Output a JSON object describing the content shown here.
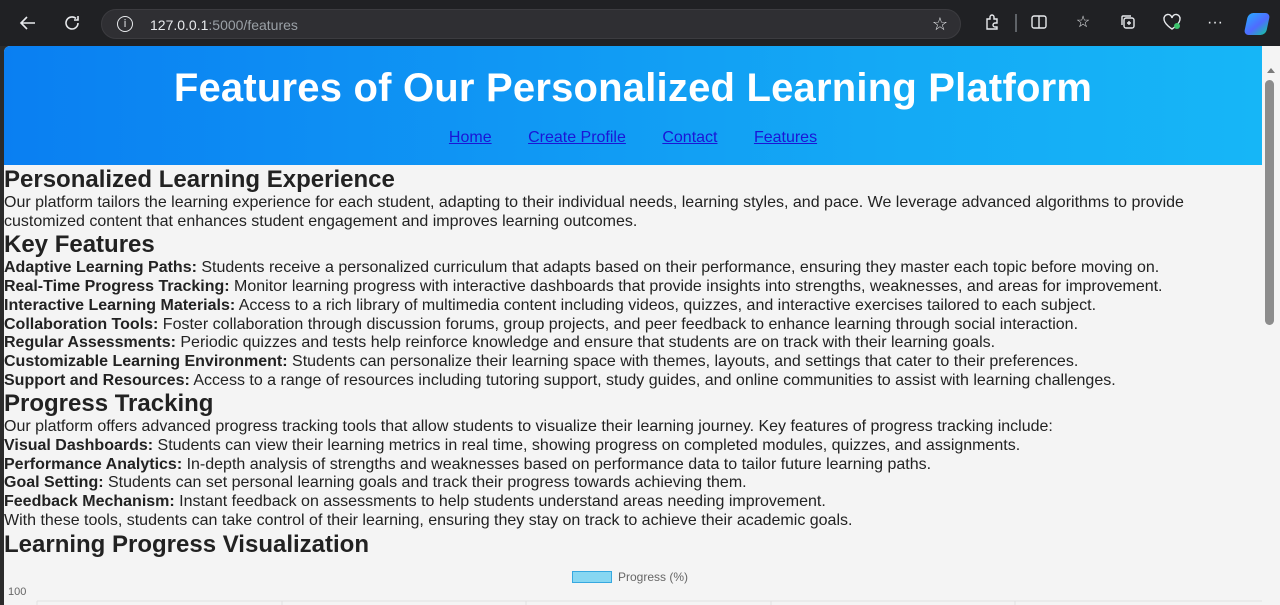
{
  "browser": {
    "url_host": "127.0.0.1",
    "url_path": ":5000/features",
    "icons": [
      "back-icon",
      "refresh-icon",
      "info-icon",
      "star-icon",
      "extensions-icon",
      "split-screen-icon",
      "favorites-icon",
      "collections-icon",
      "performance-icon",
      "more-icon",
      "copilot-icon"
    ]
  },
  "header": {
    "title": "Features of Our Personalized Learning Platform",
    "nav": [
      "Home",
      "Create Profile",
      "Contact",
      "Features"
    ]
  },
  "sections": {
    "personalized": {
      "heading": "Personalized Learning Experience",
      "text": "Our platform tailors the learning experience for each student, adapting to their individual needs, learning styles, and pace. We leverage advanced algorithms to provide customized content that enhances student engagement and improves learning outcomes."
    },
    "key_features": {
      "heading": "Key Features",
      "items": [
        {
          "label": "Adaptive Learning Paths:",
          "text": " Students receive a personalized curriculum that adapts based on their performance, ensuring they master each topic before moving on."
        },
        {
          "label": "Real-Time Progress Tracking:",
          "text": " Monitor learning progress with interactive dashboards that provide insights into strengths, weaknesses, and areas for improvement."
        },
        {
          "label": "Interactive Learning Materials:",
          "text": " Access to a rich library of multimedia content including videos, quizzes, and interactive exercises tailored to each subject."
        },
        {
          "label": "Collaboration Tools:",
          "text": " Foster collaboration through discussion forums, group projects, and peer feedback to enhance learning through social interaction."
        },
        {
          "label": "Regular Assessments:",
          "text": " Periodic quizzes and tests help reinforce knowledge and ensure that students are on track with their learning goals."
        },
        {
          "label": "Customizable Learning Environment:",
          "text": " Students can personalize their learning space with themes, layouts, and settings that cater to their preferences."
        },
        {
          "label": "Support and Resources:",
          "text": " Access to a range of resources including tutoring support, study guides, and online communities to assist with learning challenges."
        }
      ]
    },
    "progress_tracking": {
      "heading": "Progress Tracking",
      "intro": "Our platform offers advanced progress tracking tools that allow students to visualize their learning journey. Key features of progress tracking include:",
      "items": [
        {
          "label": "Visual Dashboards:",
          "text": " Students can view their learning metrics in real time, showing progress on completed modules, quizzes, and assignments."
        },
        {
          "label": "Performance Analytics:",
          "text": " In-depth analysis of strengths and weaknesses based on performance data to tailor future learning paths."
        },
        {
          "label": "Goal Setting:",
          "text": " Students can set personal learning goals and track their progress towards achieving them."
        },
        {
          "label": "Feedback Mechanism:",
          "text": " Instant feedback on assessments to help students understand areas needing improvement."
        }
      ],
      "outro": "With these tools, students can take control of their learning, ensuring they stay on track to achieve their academic goals."
    },
    "visualization": {
      "heading": "Learning Progress Visualization"
    }
  },
  "chart_data": {
    "type": "bar",
    "legend": [
      "Progress (%)"
    ],
    "y_tick_visible": [
      "100"
    ],
    "colors": {
      "fill": "#87d7f2",
      "border": "#36a8e0"
    },
    "grid": true,
    "legend_position": "top-center"
  },
  "colors": {
    "header_gradient_start": "#0a7ff2",
    "header_gradient_end": "#16b6f7",
    "link": "#1a16d6",
    "page_bg": "#f4f4f4"
  }
}
